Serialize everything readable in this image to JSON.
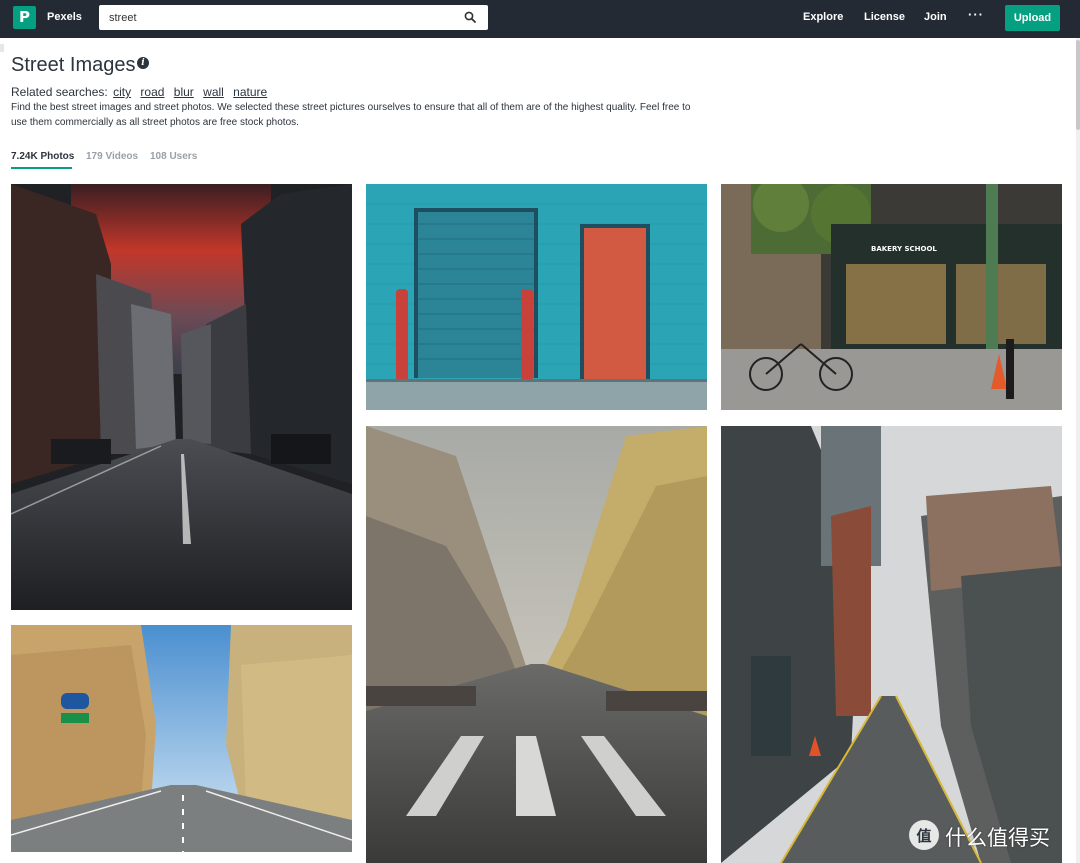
{
  "header": {
    "logo_letter": "P",
    "brand": "Pexels",
    "search_value": "street",
    "nav": {
      "explore": "Explore",
      "license": "License",
      "join": "Join",
      "more": "···",
      "upload": "Upload"
    },
    "accent_color": "#05a081",
    "bg_color": "#232a34"
  },
  "page": {
    "title": "Street Images",
    "related_label": "Related searches:",
    "related": [
      "city",
      "road",
      "blur",
      "wall",
      "nature"
    ],
    "description": "Find the best street images and street photos. We selected these street pictures ourselves to ensure that all of them are of the highest quality. Feel free to use them commercially as all street photos are free stock photos."
  },
  "tabs": [
    {
      "label": "7.24K Photos",
      "active": true
    },
    {
      "label": "179 Videos",
      "active": false
    },
    {
      "label": "108 Users",
      "active": false
    }
  ],
  "photos": [
    {
      "name": "photo-city-street-sunset",
      "sign": ""
    },
    {
      "name": "photo-teal-wall-doors",
      "sign": ""
    },
    {
      "name": "photo-bakery-storefront",
      "sign": "BAKERY SCHOOL"
    },
    {
      "name": "photo-empty-avenue",
      "sign": ""
    },
    {
      "name": "photo-alley-brick",
      "sign": ""
    },
    {
      "name": "photo-european-street",
      "sign": ""
    }
  ],
  "watermark": {
    "icon_glyph": "值",
    "text": "什么值得买"
  }
}
